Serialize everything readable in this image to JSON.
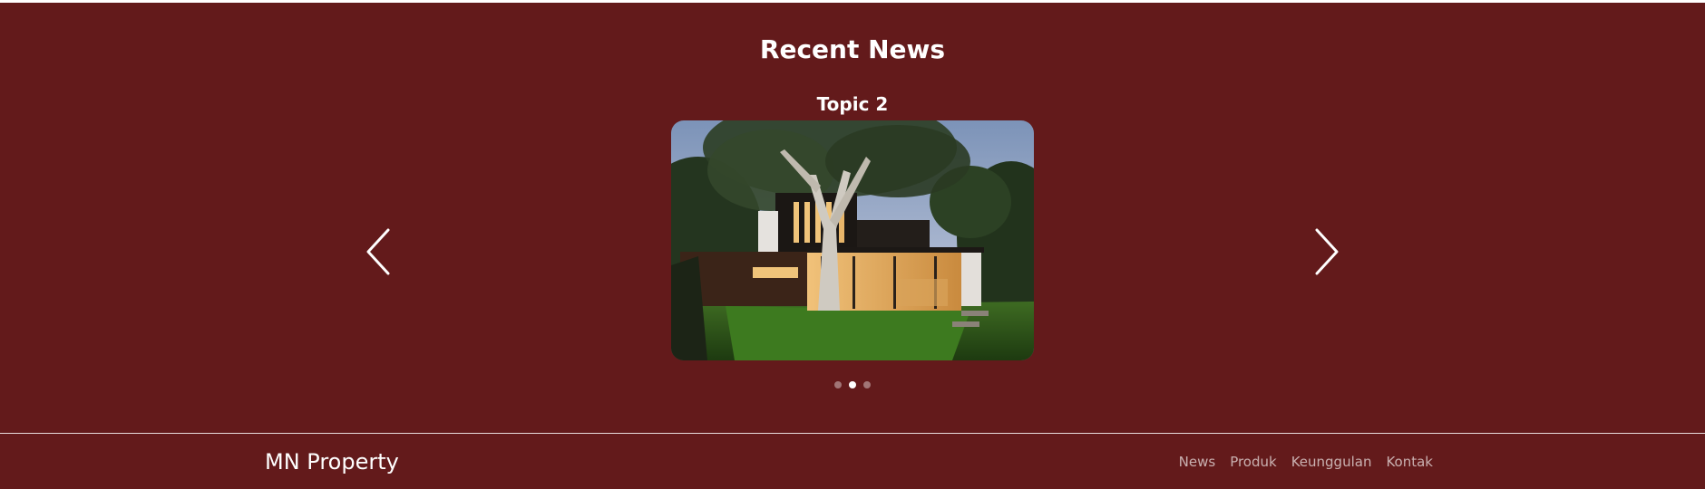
{
  "news": {
    "heading": "Recent News",
    "current_slide": {
      "title": "Topic 2",
      "image_icon": "modern-house-photo"
    },
    "slide_count": 3,
    "active_index": 1
  },
  "footer": {
    "brand": "MN Property",
    "nav": [
      {
        "label": "News"
      },
      {
        "label": "Produk"
      },
      {
        "label": "Keunggulan"
      },
      {
        "label": "Kontak"
      }
    ]
  },
  "colors": {
    "background": "#631a1b",
    "text": "#ffffff",
    "nav_text": "#c9a3a3"
  }
}
